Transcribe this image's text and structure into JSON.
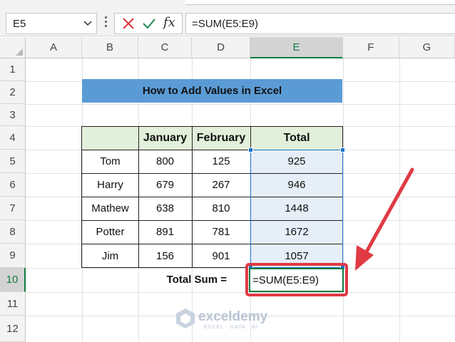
{
  "formula_bar": {
    "name_box": "E5",
    "formula": "=SUM(E5:E9)",
    "fx_label": "fx"
  },
  "columns": [
    "A",
    "B",
    "C",
    "D",
    "E",
    "F",
    "G"
  ],
  "selected_column": "E",
  "rows": [
    "1",
    "2",
    "3",
    "4",
    "5",
    "6",
    "7",
    "8",
    "9",
    "10",
    "11",
    "12"
  ],
  "selected_row": "10",
  "sheet": {
    "title": "How to Add Values in Excel",
    "headers": [
      "",
      "January",
      "February",
      "Total"
    ],
    "data": [
      [
        "Tom",
        "800",
        "125",
        "925"
      ],
      [
        "Harry",
        "679",
        "267",
        "946"
      ],
      [
        "Mathew",
        "638",
        "810",
        "1448"
      ],
      [
        "Potter",
        "891",
        "781",
        "1672"
      ],
      [
        "Jim",
        "156",
        "901",
        "1057"
      ]
    ],
    "total_label": "Total Sum =",
    "active_cell_formula": "=SUM(E5:E9)"
  },
  "colors": {
    "title_fill": "#5b9bd5",
    "header_fill": "#e2efda",
    "total_fill": "#e6eef8",
    "selection": "#1a73c8",
    "active_border": "#107c41",
    "annotation": "#e03a44"
  },
  "watermark": {
    "name": "exceldemy",
    "tagline": "EXCEL · DATA · BI"
  }
}
